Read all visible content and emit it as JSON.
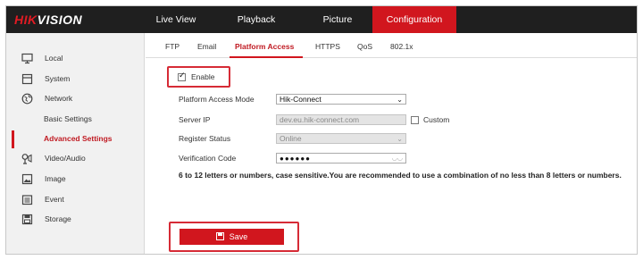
{
  "app": {
    "brand_hik": "HIK",
    "brand_vision": "VISION"
  },
  "nav": {
    "items": [
      "Live View",
      "Playback",
      "Picture",
      "Configuration"
    ],
    "active": "Configuration"
  },
  "sidebar": {
    "items": [
      {
        "label": "Local",
        "icon": "monitor-icon"
      },
      {
        "label": "System",
        "icon": "system-icon"
      },
      {
        "label": "Network",
        "icon": "globe-icon"
      },
      {
        "label": "Basic Settings"
      },
      {
        "label": "Advanced Settings",
        "active": true
      },
      {
        "label": "Video/Audio",
        "icon": "video-audio-icon"
      },
      {
        "label": "Image",
        "icon": "image-icon"
      },
      {
        "label": "Event",
        "icon": "event-icon"
      },
      {
        "label": "Storage",
        "icon": "storage-icon"
      }
    ]
  },
  "tabs": {
    "items": [
      "FTP",
      "Email",
      "Platform Access",
      "HTTPS",
      "QoS",
      "802.1x"
    ],
    "active": "Platform Access"
  },
  "form": {
    "enable_label": "Enable",
    "enable_checked": true,
    "mode_label": "Platform Access Mode",
    "mode_value": "Hik-Connect",
    "server_ip_label": "Server IP",
    "server_ip_value": "dev.eu.hik-connect.com",
    "custom_label": "Custom",
    "custom_checked": false,
    "register_label": "Register Status",
    "register_value": "Online",
    "verification_label": "Verification Code",
    "verification_value": "●●●●●●",
    "note": "6 to 12 letters or numbers, case sensitive.You are recommended to use a combination of no less than 8 letters or numbers."
  },
  "actions": {
    "save_label": "Save"
  },
  "colors": {
    "accent": "#d1161e",
    "topbar": "#1f1f1f",
    "highlight": "#d62b36"
  }
}
